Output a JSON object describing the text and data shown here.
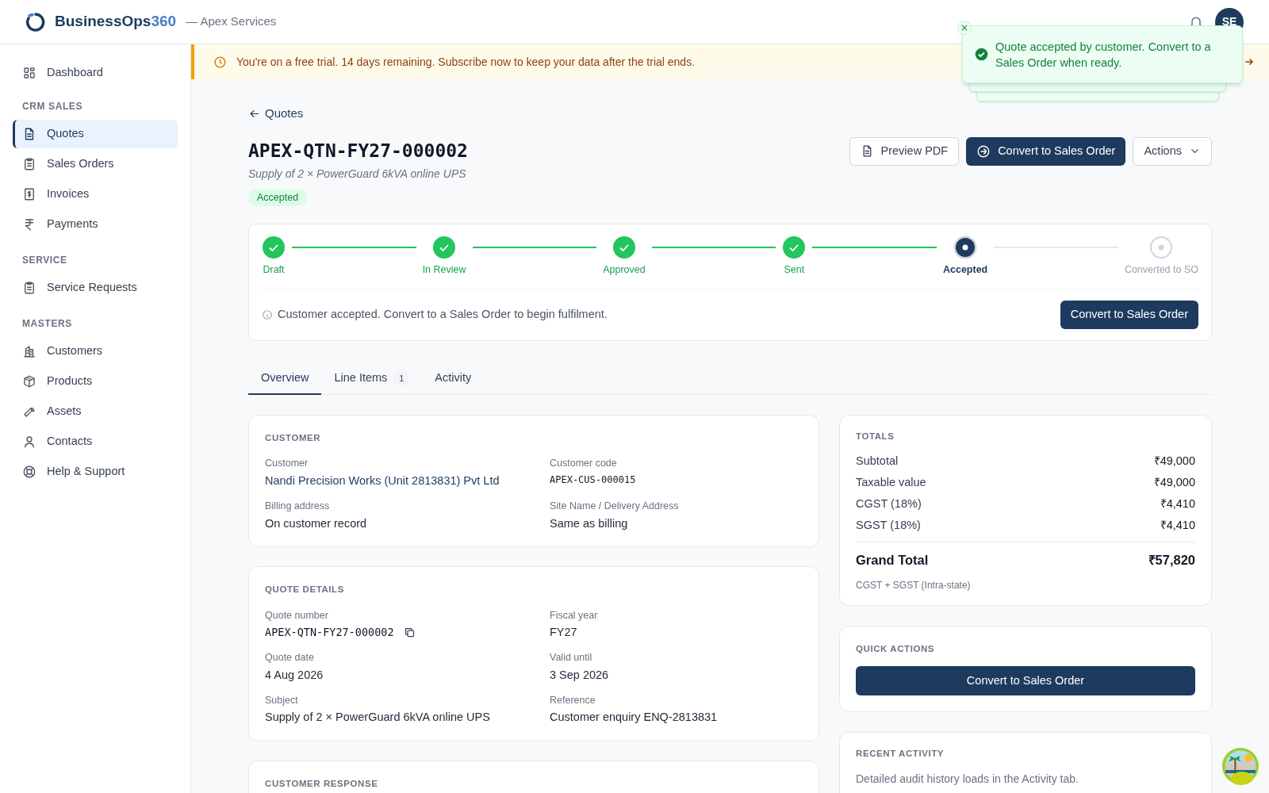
{
  "header": {
    "brand": "BusinessOps",
    "brand_suffix": "360",
    "org": "— Apex Services",
    "avatar": "SE"
  },
  "sidebar": {
    "sections": [
      {
        "items": [
          {
            "label": "Dashboard",
            "selected": false
          }
        ]
      },
      {
        "title": "CRM SALES",
        "items": [
          {
            "label": "Quotes",
            "selected": true
          },
          {
            "label": "Sales Orders",
            "selected": false
          },
          {
            "label": "Invoices",
            "selected": false
          },
          {
            "label": "Payments",
            "selected": false
          }
        ]
      },
      {
        "title": "SERVICE",
        "items": [
          {
            "label": "Service Requests",
            "selected": false
          }
        ]
      },
      {
        "title": "MASTERS",
        "items": [
          {
            "label": "Customers",
            "selected": false
          },
          {
            "label": "Products",
            "selected": false
          },
          {
            "label": "Assets",
            "selected": false
          },
          {
            "label": "Contacts",
            "selected": false
          },
          {
            "label": "Help & Support",
            "selected": false
          }
        ]
      }
    ]
  },
  "trial_banner": {
    "text": "You're on a free trial. 14 days remaining. Subscribe now to keep your data after the trial ends."
  },
  "toast": {
    "message": "Quote accepted by customer. Convert to a Sales Order when ready."
  },
  "back_link": "Quotes",
  "quote": {
    "number": "APEX-QTN-FY27-000002",
    "subtitle": "Supply of 2 × PowerGuard 6kVA online UPS",
    "status": "Accepted"
  },
  "actions": {
    "preview": "Preview PDF",
    "convert": "Convert to Sales Order",
    "more": "Actions"
  },
  "stepper": {
    "steps": [
      {
        "label": "Draft",
        "kind": "done"
      },
      {
        "label": "In Review",
        "kind": "done"
      },
      {
        "label": "Approved",
        "kind": "done"
      },
      {
        "label": "Sent",
        "kind": "done"
      },
      {
        "label": "Accepted",
        "kind": "current"
      },
      {
        "label": "Converted to SO",
        "kind": "pending"
      }
    ],
    "note": "Customer accepted. Convert to a Sales Order to begin fulfilment.",
    "button": "Convert to Sales Order"
  },
  "tabs": [
    {
      "label": "Overview",
      "selected": true
    },
    {
      "label": "Line Items",
      "count": "1",
      "selected": false
    },
    {
      "label": "Activity",
      "selected": false
    }
  ],
  "cards": [
    {
      "title": "CUSTOMER",
      "fields": [
        {
          "label": "Customer",
          "value": "Nandi Precision Works (Unit 2813831) Pvt Ltd",
          "kind": "link"
        },
        {
          "label": "Customer code",
          "value": "APEX-CUS-000015",
          "kind": "code"
        },
        {
          "label": "Billing address",
          "value": "On customer record",
          "kind": "text"
        },
        {
          "label": "Site Name / Delivery Address",
          "value": "Same as billing",
          "kind": "text"
        }
      ]
    },
    {
      "title": "QUOTE DETAILS",
      "fields": [
        {
          "label": "Quote number",
          "value": "APEX-QTN-FY27-000002",
          "kind": "copy"
        },
        {
          "label": "Fiscal year",
          "value": "FY27",
          "kind": "text"
        },
        {
          "label": "Quote date",
          "value": "4 Aug 2026",
          "kind": "text"
        },
        {
          "label": "Valid until",
          "value": "3 Sep 2026",
          "kind": "text"
        },
        {
          "label": "Subject",
          "value": "Supply of 2 × PowerGuard 6kVA online UPS",
          "kind": "text"
        },
        {
          "label": "Reference",
          "value": "Customer enquiry ENQ-2813831",
          "kind": "text"
        }
      ]
    },
    {
      "title": "CUSTOMER RESPONSE"
    }
  ],
  "totals": {
    "title": "TOTALS",
    "rows": [
      {
        "label": "Subtotal",
        "value": "₹49,000"
      },
      {
        "label": "Taxable value",
        "value": "₹49,000"
      },
      {
        "label": "CGST (18%)",
        "value": "₹4,410"
      },
      {
        "label": "SGST (18%)",
        "value": "₹4,410"
      }
    ],
    "grand_label": "Grand Total",
    "grand_value": "₹57,820",
    "note": "CGST + SGST (Intra-state)"
  },
  "quick_actions": {
    "title": "QUICK ACTIONS",
    "button": "Convert to Sales Order"
  },
  "recent_activity": {
    "title": "RECENT ACTIVITY",
    "text": "Detailed audit history loads in the Activity tab."
  }
}
